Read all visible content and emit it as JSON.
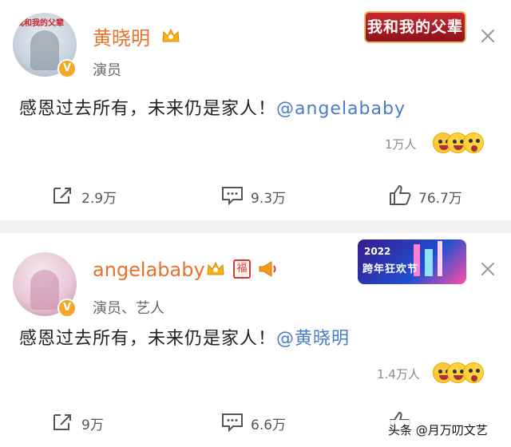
{
  "posts": [
    {
      "avatar_caption": "我和我的父辈",
      "username": "黄晓明",
      "role": "演员",
      "banner": "我和我的父辈",
      "text": "感恩过去所有，未来仍是家人！",
      "mention": "@angelababy",
      "likes_count": "1万人",
      "actions": {
        "share": "2.9万",
        "comment": "9.3万",
        "like": "76.7万"
      },
      "badge_icons": [
        "crown-icon"
      ]
    },
    {
      "username": "angelababy",
      "role": "演员、艺人",
      "badge_fu": "福",
      "banner_year": "2022",
      "banner_label": "跨年狂欢节",
      "text": "感恩过去所有，未来仍是家人！",
      "mention": "@黄晓明",
      "likes_count": "1.4万人",
      "actions": {
        "share": "9万",
        "comment": "6.6万",
        "like": ""
      },
      "badge_icons": [
        "crown-icon",
        "fu-badge-icon",
        "megaphone-icon"
      ]
    }
  ],
  "verified_mark": "V",
  "watermark": "头条 @月万叨文艺",
  "colors": {
    "username": "#e8712a",
    "mention": "#4a7cc9",
    "verified": "#f5a623"
  }
}
